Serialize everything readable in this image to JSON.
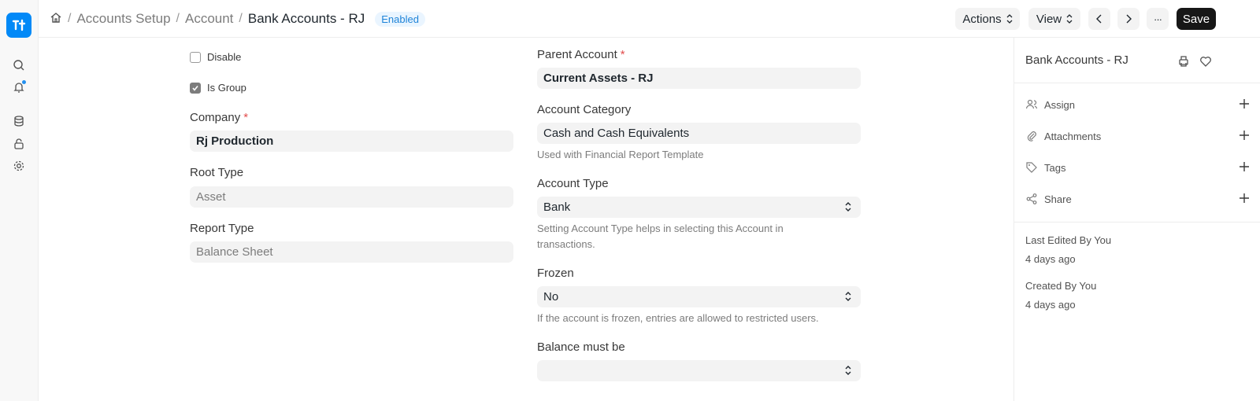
{
  "breadcrumb": {
    "items": [
      "Accounts Setup",
      "Account"
    ],
    "current": "Bank Accounts - RJ",
    "status": "Enabled"
  },
  "toolbar": {
    "actions_label": "Actions",
    "view_label": "View",
    "more_label": "···",
    "save_label": "Save"
  },
  "form": {
    "disable_label": "Disable",
    "disable_checked": false,
    "is_group_label": "Is Group",
    "is_group_checked": true,
    "company": {
      "label": "Company",
      "required": "*",
      "value": "Rj Production"
    },
    "root_type": {
      "label": "Root Type",
      "value": "Asset"
    },
    "report_type": {
      "label": "Report Type",
      "value": "Balance Sheet"
    },
    "parent_account": {
      "label": "Parent Account",
      "required": "*",
      "value": "Current Assets - RJ"
    },
    "account_category": {
      "label": "Account Category",
      "value": "Cash and Cash Equivalents",
      "help": "Used with Financial Report Template"
    },
    "account_type": {
      "label": "Account Type",
      "value": "Bank",
      "help_line1": "Setting Account Type helps in selecting this Account in",
      "help_line2": "transactions."
    },
    "frozen": {
      "label": "Frozen",
      "value": "No",
      "help": "If the account is frozen, entries are allowed to restricted users."
    },
    "balance_must_be": {
      "label": "Balance must be",
      "value": ""
    }
  },
  "sidebar": {
    "title": "Bank Accounts - RJ",
    "assign": "Assign",
    "attachments": "Attachments",
    "tags": "Tags",
    "share": "Share",
    "last_edited": "Last Edited By You",
    "last_edited_time": "4 days ago",
    "created": "Created By You",
    "created_time": "4 days ago"
  },
  "colors": {
    "accent": "#0289f7",
    "badge_text": "#1f84d8",
    "primary_button": "#171717"
  }
}
